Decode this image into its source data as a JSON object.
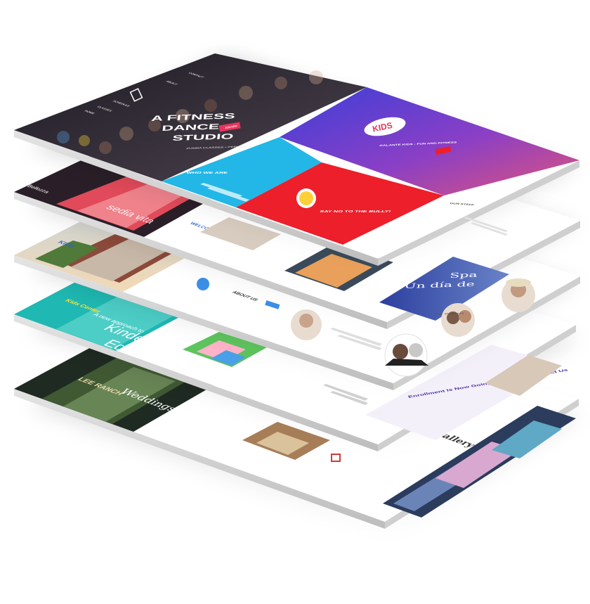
{
  "colors": {
    "fitness_dark": "#2a2730",
    "fitness_pink": "#e8345c",
    "cyan": "#22b7e6",
    "red": "#ec1f2b",
    "purple": "#6a3fd6",
    "magenta": "#c83a9c",
    "navy": "#2a3ca8",
    "teal": "#1fb8b2",
    "olive": "#4c6a3a",
    "brown": "#8c6a4a"
  },
  "layer1": {
    "nav": [
      "HOME",
      "CLASSES",
      "SCHEDULE",
      "ABOUT",
      "CONTACT"
    ],
    "hero_title_line1": "A FITNESS",
    "hero_title_line2": "DANCE",
    "hero_title_line3": "STUDIO",
    "hero_subtitle": "ZUMBA CLASSES • PERSONAL TRAINING • POUND FIT • PILATES",
    "hero_button": "JOIN NOW",
    "who_we_are": "WHO WE ARE",
    "kids_logo": "KIDS",
    "kids_tagline": "GALANTE KIDS - FUN AND FITNESS",
    "bully": "SAY NO TO THE BULLY!",
    "our_staff": "OUR STAFF"
  },
  "layer2": {
    "logo": "Bellezza",
    "hero_text": "sedia vita",
    "welcome": "WELCOME TO",
    "spa_line1": "Un día de",
    "spa_line2": "Spa",
    "testimonial": "Our Patients"
  },
  "layer3": {
    "about": "ABOUT US",
    "button": "READ MORE"
  },
  "layer4": {
    "logo": "Kids Center",
    "hero_line1": "A new approach to",
    "hero_line2": "Kinder",
    "hero_line3": "Educa",
    "enroll": "Enrollment Is Now Going On. Please Contact Us"
  },
  "layer5": {
    "logo": "LEE RANCH",
    "hero": "Weddings",
    "gallery": "Gallery"
  }
}
